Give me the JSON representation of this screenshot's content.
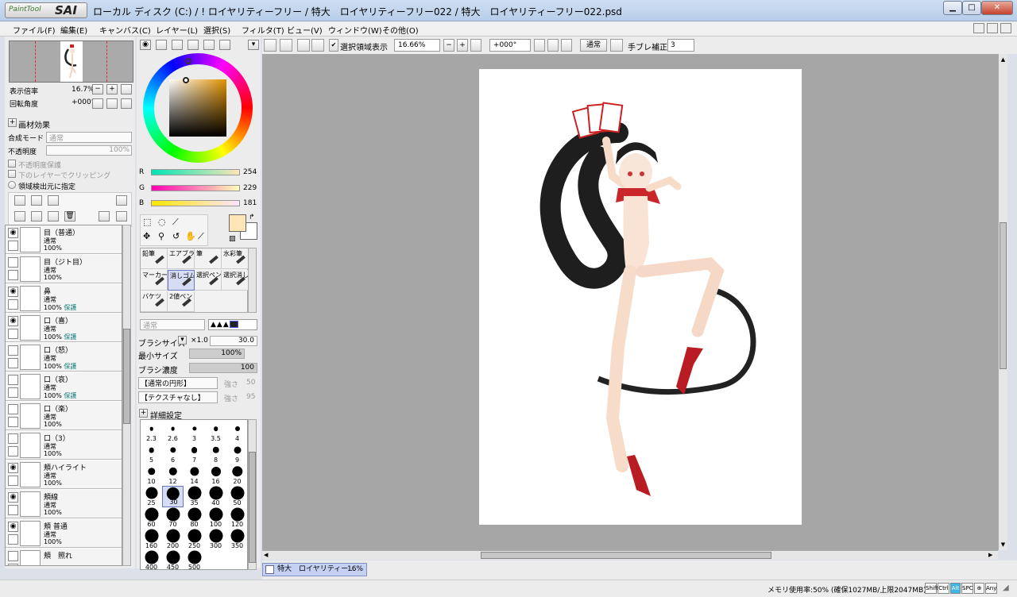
{
  "window": {
    "logo_small": "PaintTool",
    "logo_big": "SAI",
    "title": "ローカル ディスク (C:) / ! ロイヤリティーフリー / 特大　ロイヤリティーフリー022 / 特大　ロイヤリティーフリー022.psd",
    "btn_min": "▁",
    "btn_max": "□",
    "btn_close": "✕"
  },
  "menu": [
    "ファイル(F)",
    "編集(E)",
    "キャンバス(C)",
    "レイヤー(L)",
    "選択(S)",
    "フィルタ(T)",
    "ビュー(V)",
    "ウィンドウ(W)",
    "その他(O)"
  ],
  "toolbar": {
    "selection_check": "✔",
    "selection_label": "選択領域表示",
    "zoom": "16.66%",
    "rotation": "+000°",
    "blend": "通常",
    "stabilizer_label": "手ブレ補正",
    "stabilizer_value": "3"
  },
  "navigator": {
    "zoom_label": "表示倍率",
    "zoom_value": "16.7%",
    "rotation_label": "回転角度",
    "rotation_value": "+000°"
  },
  "layer_props": {
    "effect_label": "画材効果",
    "blend_label": "合成モード",
    "blend_value": "通常",
    "opacity_label": "不透明度",
    "opacity_value": "100%",
    "protect_opacity": "不透明度保護",
    "clip_lower": "下のレイヤーでクリッピング",
    "selection_source": "領域検出元に指定"
  },
  "layers": [
    {
      "name": "目（普通）",
      "mode": "通常",
      "opacity": "100%",
      "protect": "",
      "visible": true
    },
    {
      "name": "目（ジト目）",
      "mode": "通常",
      "opacity": "100%",
      "protect": "",
      "visible": false
    },
    {
      "name": "鼻",
      "mode": "通常",
      "opacity": "100%",
      "protect": "保護",
      "visible": true
    },
    {
      "name": "口（喜）",
      "mode": "通常",
      "opacity": "100%",
      "protect": "保護",
      "visible": true
    },
    {
      "name": "口（怒）",
      "mode": "通常",
      "opacity": "100%",
      "protect": "保護",
      "visible": false
    },
    {
      "name": "口（哀）",
      "mode": "通常",
      "opacity": "100%",
      "protect": "保護",
      "visible": false
    },
    {
      "name": "口（楽）",
      "mode": "通常",
      "opacity": "100%",
      "protect": "",
      "visible": false
    },
    {
      "name": "口（3）",
      "mode": "通常",
      "opacity": "100%",
      "protect": "",
      "visible": false
    },
    {
      "name": "頬ハイライト",
      "mode": "通常",
      "opacity": "100%",
      "protect": "",
      "visible": true
    },
    {
      "name": "頬線",
      "mode": "通常",
      "opacity": "100%",
      "protect": "",
      "visible": true
    },
    {
      "name": "頬 普通",
      "mode": "通常",
      "opacity": "100%",
      "protect": "",
      "visible": true
    },
    {
      "name": "頬　照れ",
      "mode": "",
      "opacity": "",
      "protect": "",
      "visible": false
    }
  ],
  "color": {
    "r_label": "R",
    "r": "254",
    "g_label": "G",
    "g": "229",
    "b_label": "B",
    "b": "181",
    "fg": "#fee5b5"
  },
  "tools": [
    "鉛筆",
    "エアブラシ",
    "筆",
    "水彩筆",
    "マーカー",
    "消しゴム",
    "選択ペン",
    "選択消し",
    "バケツ",
    "2値ペン"
  ],
  "brush": {
    "blend_value": "通常",
    "size_label": "ブラシサイズ",
    "size_mult": "×1.0",
    "size_value": "30.0",
    "min_size_label": "最小サイズ",
    "min_size_value": "100%",
    "density_label": "ブラシ濃度",
    "density_value": "100",
    "shape": "【通常の円形】",
    "shape_strength_label": "強さ",
    "shape_strength": "50",
    "texture": "【テクスチャなし】",
    "texture_strength_label": "強さ",
    "texture_strength": "95",
    "advanced": "詳細設定"
  },
  "brush_sizes": [
    "2.3",
    "2.6",
    "3",
    "3.5",
    "4",
    "5",
    "6",
    "7",
    "8",
    "9",
    "10",
    "12",
    "14",
    "16",
    "20",
    "25",
    "30",
    "35",
    "40",
    "50",
    "60",
    "70",
    "80",
    "100",
    "120",
    "160",
    "200",
    "250",
    "300",
    "350",
    "400",
    "450",
    "500"
  ],
  "document_tab": {
    "name": "特大　ロイヤリティー…",
    "zoom": "16%"
  },
  "status": {
    "memory": "メモリ使用率:50% (確保1027MB/上限2047MB)",
    "keys": [
      "Shift",
      "Ctrl",
      "Alt",
      "SPC",
      "⊕",
      "Any"
    ]
  }
}
